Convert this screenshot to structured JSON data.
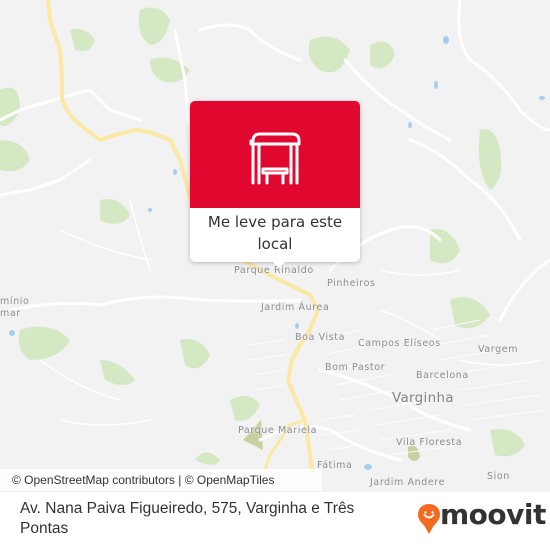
{
  "map": {
    "colors": {
      "background": "#f2f2f2",
      "major_road": "#fbe8a3",
      "minor_road": "#ffffff",
      "park": "#d5e8c4",
      "water": "#a7cdf2"
    },
    "place_labels": [
      {
        "id": "parque-rinaldo",
        "text": "Parque Rinaldo"
      },
      {
        "id": "pinheiros",
        "text": "Pinheiros"
      },
      {
        "id": "jardim-aurea",
        "text": "Jardim Áurea"
      },
      {
        "id": "boa-vista",
        "text": "Boa Vista"
      },
      {
        "id": "campos-eliseos",
        "text": "Campos Elíseos"
      },
      {
        "id": "vargem",
        "text": "Vargem"
      },
      {
        "id": "bom-pastor",
        "text": "Bom Pastor"
      },
      {
        "id": "barcelona",
        "text": "Barcelona"
      },
      {
        "id": "varginha",
        "text": "Varginha"
      },
      {
        "id": "parque-mariela",
        "text": "Parque Mariela"
      },
      {
        "id": "vila-floresta",
        "text": "Vila Floresta"
      },
      {
        "id": "fatima",
        "text": "Fátima"
      },
      {
        "id": "jardim-andere",
        "text": "Jardim Andere"
      },
      {
        "id": "sion",
        "text": "Sion"
      },
      {
        "id": "dominio-line1",
        "text": "mínio"
      },
      {
        "id": "dominio-line2",
        "text": "mar"
      }
    ]
  },
  "popup": {
    "icon": "bus-stop-icon",
    "label": "Me leve para este local",
    "color": "#e0082f"
  },
  "attribution": "© OpenStreetMap contributors | © OpenMapTiles",
  "footer": {
    "address": "Av. Nana Paiva Figueiredo, 575, Varginha e Três Pontas",
    "brand": "moovit",
    "brand_color": "#f26b21"
  }
}
